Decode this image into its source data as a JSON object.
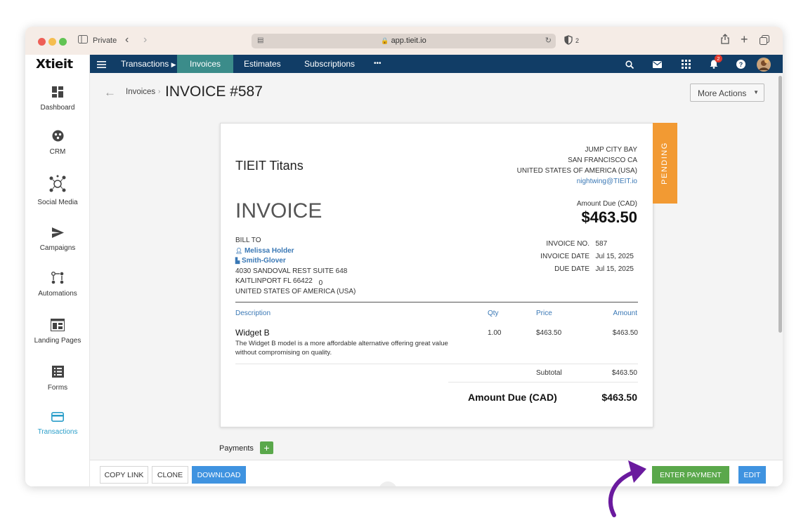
{
  "browser": {
    "private_label": "Private",
    "url": "app.tieit.io",
    "shield_count": "2"
  },
  "topnav": {
    "items": [
      "Transactions",
      "Invoices",
      "Estimates",
      "Subscriptions",
      "•••"
    ],
    "notification_count": "2"
  },
  "logo": "Xtieit",
  "sidebar": {
    "items": [
      "Dashboard",
      "CRM",
      "Social Media",
      "Campaigns",
      "Automations",
      "Landing Pages",
      "Forms",
      "Transactions"
    ]
  },
  "page": {
    "breadcrumb": "Invoices",
    "title": "INVOICE #587",
    "more_actions": "More Actions"
  },
  "invoice": {
    "company": "TIEIT Titans",
    "address_lines": [
      "JUMP CITY BAY",
      "SAN FRANCISCO CA",
      "UNITED STATES OF AMERICA (USA)"
    ],
    "email": "nightwing@TIEIT.io",
    "status": "PENDING",
    "heading": "INVOICE",
    "amount_due_label": "Amount Due (CAD)",
    "amount_due": "$463.50",
    "bill_to_label": "BILL TO",
    "contact": "Melissa Holder",
    "company_client": "Smith-Glover",
    "client_address": [
      "4030 SANDOVAL REST SUITE 648",
      "KAITLINPORT FL 66422",
      "UNITED STATES OF AMERICA (USA)"
    ],
    "stray_char": "0",
    "meta": [
      {
        "label": "INVOICE NO.",
        "value": "587"
      },
      {
        "label": "INVOICE DATE",
        "value": "Jul 15, 2025"
      },
      {
        "label": "DUE DATE",
        "value": "Jul 15, 2025"
      }
    ],
    "columns": [
      "Description",
      "Qty",
      "Price",
      "Amount"
    ],
    "line_items": [
      {
        "name": "Widget B",
        "description_1": "The Widget B model is a more affordable alternative offering great value",
        "description_2": "without compromising on quality.",
        "qty": "1.00",
        "price": "$463.50",
        "amount": "$463.50"
      }
    ],
    "subtotal_label": "Subtotal",
    "subtotal": "$463.50",
    "total_label": "Amount Due (CAD)",
    "total": "$463.50"
  },
  "payments_label": "Payments",
  "actions": {
    "copy_link": "COPY LINK",
    "clone": "CLONE",
    "download": "DOWNLOAD",
    "enter_payment": "ENTER PAYMENT",
    "edit": "EDIT"
  },
  "colors": {
    "nav_bg": "#113d66",
    "nav_active": "#3b8c8a",
    "pending": "#f29a33",
    "download": "#3f93e0",
    "enter_payment": "#5aa84b",
    "arrow": "#6a1a9e"
  }
}
